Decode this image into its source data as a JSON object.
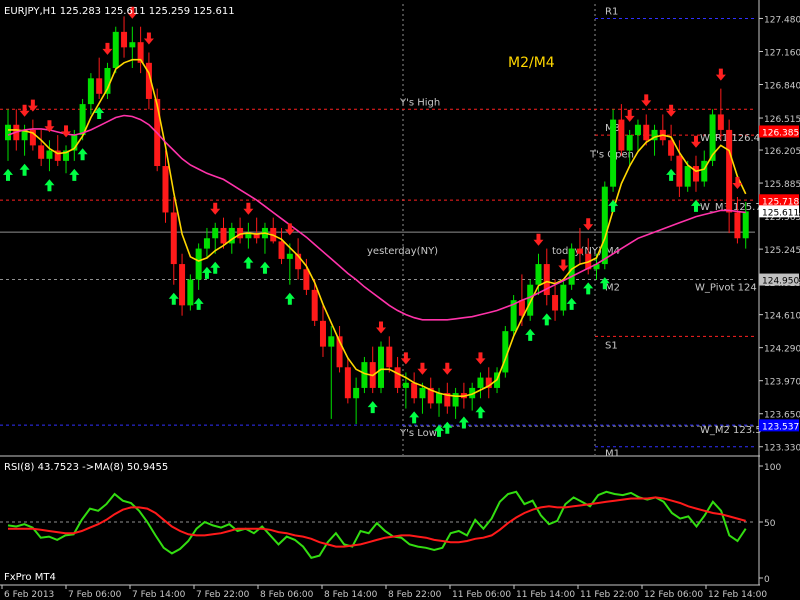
{
  "window": {
    "symbol_header": "EURJPY,H1  125.283 125.611 125.259 125.611",
    "strategy_label": "M2/M4",
    "broker_label": "FxPro MT4"
  },
  "colors": {
    "background": "#000000",
    "axis": "#c8c8c8",
    "bull": "#00e000",
    "bear": "#ff1a1a",
    "ma_fast": "#ffd700",
    "ma_slow": "#ff33aa",
    "arrow_up": "#00ff44",
    "arrow_down": "#ff2020",
    "rsi": "#33dd11",
    "rsi_ma": "#ff1a1a",
    "red_level": "#ff2020",
    "blue_level": "#3030ff",
    "grey_line": "#909090",
    "strategy": "#ffd700"
  },
  "chart_data": [
    {
      "type": "candlestick",
      "title": "EURJPY,H1  125.283 125.611 125.259 125.611",
      "y_ticks": [
        "127.480",
        "127.160",
        "126.840",
        "126.515",
        "126.205",
        "125.885",
        "125.565",
        "125.245",
        "124.925",
        "124.610",
        "124.290",
        "123.970",
        "123.650",
        "123.330"
      ],
      "x_ticks": [
        "6 Feb 2013",
        "7 Feb 06:00",
        "7 Feb 14:00",
        "7 Feb 22:00",
        "8 Feb 06:00",
        "8 Feb 14:00",
        "8 Feb 22:00",
        "11 Feb 06:00",
        "11 Feb 14:00",
        "11 Feb 22:00",
        "12 Feb 06:00",
        "12 Feb 14:00"
      ],
      "ylim": [
        123.25,
        127.62
      ],
      "candles": [
        [
          126.3,
          126.6,
          126.1,
          126.45
        ],
        [
          126.45,
          126.6,
          126.2,
          126.3
        ],
        [
          126.3,
          126.45,
          126.15,
          126.4
        ],
        [
          126.4,
          126.5,
          126.2,
          126.25
        ],
        [
          126.25,
          126.4,
          126.05,
          126.12
        ],
        [
          126.12,
          126.3,
          126.0,
          126.2
        ],
        [
          126.2,
          126.35,
          126.05,
          126.1
        ],
        [
          126.1,
          126.25,
          125.98,
          126.2
        ],
        [
          126.2,
          126.4,
          126.1,
          126.35
        ],
        [
          126.35,
          126.7,
          126.3,
          126.65
        ],
        [
          126.65,
          126.95,
          126.55,
          126.9
        ],
        [
          126.9,
          127.1,
          126.7,
          126.75
        ],
        [
          126.75,
          127.05,
          126.7,
          127.0
        ],
        [
          127.0,
          127.4,
          126.95,
          127.35
        ],
        [
          127.35,
          127.5,
          127.1,
          127.2
        ],
        [
          127.2,
          127.4,
          127.0,
          127.25
        ],
        [
          127.25,
          127.4,
          126.95,
          127.05
        ],
        [
          127.05,
          127.15,
          126.6,
          126.7
        ],
        [
          126.7,
          126.8,
          126.0,
          126.05
        ],
        [
          126.05,
          126.2,
          125.5,
          125.6
        ],
        [
          125.6,
          125.75,
          124.9,
          125.1
        ],
        [
          125.1,
          125.2,
          124.6,
          124.7
        ],
        [
          124.7,
          125.0,
          124.65,
          124.95
        ],
        [
          124.95,
          125.3,
          124.85,
          125.25
        ],
        [
          125.25,
          125.45,
          125.15,
          125.35
        ],
        [
          125.35,
          125.5,
          125.2,
          125.45
        ],
        [
          125.45,
          125.55,
          125.25,
          125.3
        ],
        [
          125.3,
          125.5,
          125.2,
          125.45
        ],
        [
          125.45,
          125.55,
          125.3,
          125.35
        ],
        [
          125.35,
          125.5,
          125.25,
          125.4
        ],
        [
          125.4,
          125.55,
          125.3,
          125.35
        ],
        [
          125.35,
          125.5,
          125.2,
          125.45
        ],
        [
          125.45,
          125.55,
          125.3,
          125.32
        ],
        [
          125.32,
          125.45,
          125.1,
          125.15
        ],
        [
          125.15,
          125.3,
          124.9,
          125.2
        ],
        [
          125.2,
          125.35,
          124.95,
          125.05
        ],
        [
          125.05,
          125.15,
          124.8,
          124.85
        ],
        [
          124.85,
          124.95,
          124.5,
          124.55
        ],
        [
          124.55,
          124.7,
          124.2,
          124.3
        ],
        [
          124.3,
          124.5,
          123.6,
          124.4
        ],
        [
          124.4,
          124.5,
          124.05,
          124.1
        ],
        [
          124.1,
          124.2,
          123.75,
          123.8
        ],
        [
          123.8,
          124.0,
          123.55,
          123.9
        ],
        [
          123.9,
          124.2,
          123.85,
          124.15
        ],
        [
          124.15,
          124.3,
          123.85,
          123.9
        ],
        [
          123.9,
          124.35,
          123.85,
          124.3
        ],
        [
          124.3,
          124.4,
          124.05,
          124.1
        ],
        [
          124.1,
          124.2,
          123.85,
          123.9
        ],
        [
          123.9,
          124.05,
          123.7,
          123.95
        ],
        [
          123.95,
          124.05,
          123.75,
          123.8
        ],
        [
          123.8,
          123.95,
          123.65,
          123.9
        ],
        [
          123.9,
          124.0,
          123.7,
          123.75
        ],
        [
          123.75,
          123.9,
          123.62,
          123.85
        ],
        [
          123.85,
          123.95,
          123.65,
          123.72
        ],
        [
          123.72,
          123.9,
          123.6,
          123.85
        ],
        [
          123.85,
          123.95,
          123.7,
          123.8
        ],
        [
          123.8,
          123.95,
          123.68,
          123.9
        ],
        [
          123.9,
          124.05,
          123.8,
          124.0
        ],
        [
          124.0,
          124.1,
          123.8,
          123.9
        ],
        [
          123.9,
          124.1,
          123.85,
          124.05
        ],
        [
          124.05,
          124.5,
          124.0,
          124.45
        ],
        [
          124.45,
          124.8,
          124.4,
          124.75
        ],
        [
          124.75,
          125.0,
          124.5,
          124.6
        ],
        [
          124.6,
          124.95,
          124.55,
          124.9
        ],
        [
          124.9,
          125.2,
          124.8,
          125.1
        ],
        [
          125.1,
          125.25,
          124.7,
          124.8
        ],
        [
          124.8,
          124.95,
          124.55,
          124.65
        ],
        [
          124.65,
          124.95,
          124.6,
          124.9
        ],
        [
          124.9,
          125.3,
          124.85,
          125.25
        ],
        [
          125.25,
          125.45,
          125.1,
          125.2
        ],
        [
          125.2,
          125.35,
          125.0,
          125.05
        ],
        [
          125.05,
          125.2,
          124.95,
          125.1
        ],
        [
          125.1,
          125.9,
          125.05,
          125.85
        ],
        [
          125.85,
          126.6,
          125.8,
          126.5
        ],
        [
          126.5,
          126.65,
          126.15,
          126.2
        ],
        [
          126.2,
          126.4,
          126.05,
          126.35
        ],
        [
          126.35,
          126.5,
          126.2,
          126.45
        ],
        [
          126.45,
          126.55,
          126.25,
          126.3
        ],
        [
          126.3,
          126.45,
          126.15,
          126.4
        ],
        [
          126.4,
          126.55,
          126.25,
          126.3
        ],
        [
          126.3,
          126.45,
          126.1,
          126.15
        ],
        [
          126.15,
          126.3,
          125.75,
          125.85
        ],
        [
          125.85,
          126.1,
          125.8,
          126.05
        ],
        [
          126.05,
          126.15,
          125.8,
          125.9
        ],
        [
          125.9,
          126.2,
          125.85,
          126.1
        ],
        [
          126.1,
          126.6,
          126.05,
          126.55
        ],
        [
          126.55,
          126.8,
          126.3,
          126.4
        ],
        [
          126.4,
          126.5,
          125.4,
          125.6
        ],
        [
          125.6,
          125.75,
          125.3,
          125.35
        ],
        [
          125.35,
          125.7,
          125.25,
          125.61
        ]
      ],
      "series": [
        {
          "name": "",
          "values": [
            126.4,
            126.4,
            126.39,
            126.37,
            126.3,
            126.22,
            126.17,
            126.18,
            126.22,
            126.34,
            126.52,
            126.66,
            126.8,
            126.99,
            127.05,
            127.08,
            127.08,
            126.95,
            126.64,
            126.24,
            125.79,
            125.39,
            125.17,
            125.13,
            125.16,
            125.23,
            125.28,
            125.34,
            125.39,
            125.4,
            125.39,
            125.4,
            125.38,
            125.34,
            125.26,
            125.18,
            125.08,
            124.92,
            124.71,
            124.53,
            124.35,
            124.19,
            124.08,
            124.04,
            124.02,
            124.08,
            124.08,
            124.04,
            124.0,
            123.95,
            123.92,
            123.88,
            123.85,
            123.83,
            123.82,
            123.82,
            123.84,
            123.88,
            123.92,
            123.98,
            124.18,
            124.4,
            124.57,
            124.73,
            124.89,
            124.93,
            124.91,
            124.95,
            125.05,
            125.1,
            125.12,
            125.16,
            125.35,
            125.62,
            125.88,
            126.05,
            126.19,
            126.28,
            126.33,
            126.35,
            126.33,
            126.18,
            126.06,
            126.0,
            126.02,
            126.16,
            126.25,
            126.2,
            125.95,
            125.78
          ]
        },
        {
          "name": "",
          "values": [
            126.35,
            126.38,
            126.4,
            126.41,
            126.41,
            126.4,
            126.38,
            126.36,
            126.35,
            126.37,
            126.4,
            126.44,
            126.48,
            126.52,
            126.54,
            126.53,
            126.5,
            126.45,
            126.37,
            126.28,
            126.2,
            126.12,
            126.06,
            126.02,
            125.98,
            125.95,
            125.92,
            125.87,
            125.82,
            125.77,
            125.72,
            125.66,
            125.6,
            125.54,
            125.48,
            125.42,
            125.36,
            125.29,
            125.22,
            125.15,
            125.08,
            125.01,
            124.95,
            124.88,
            124.82,
            124.76,
            124.7,
            124.65,
            124.61,
            124.58,
            124.56,
            124.56,
            124.56,
            124.56,
            124.57,
            124.58,
            124.59,
            124.61,
            124.63,
            124.65,
            124.68,
            124.71,
            124.75,
            124.78,
            124.82,
            124.86,
            124.9,
            124.94,
            124.98,
            125.02,
            125.06,
            125.1,
            125.15,
            125.2,
            125.25,
            125.3,
            125.35,
            125.38,
            125.41,
            125.44,
            125.47,
            125.5,
            125.53,
            125.56,
            125.58,
            125.6,
            125.62,
            125.62,
            125.61,
            125.6
          ]
        }
      ],
      "arrows_up": [
        0,
        2,
        5,
        8,
        9,
        11,
        20,
        23,
        24,
        25,
        29,
        31,
        34,
        44,
        49,
        52,
        53,
        55,
        57,
        63,
        65,
        68,
        70,
        72,
        73,
        80,
        83
      ],
      "arrows_down": [
        2,
        3,
        5,
        7,
        12,
        15,
        17,
        25,
        29,
        34,
        45,
        48,
        50,
        53,
        57,
        64,
        67,
        70,
        75,
        77,
        80,
        83,
        86,
        88
      ],
      "levels": [
        {
          "label": "R1",
          "value": 127.48,
          "style": "blue"
        },
        {
          "label": "Y's High",
          "value": 126.6,
          "style": "redgrey"
        },
        {
          "label": "M3",
          "value": 126.35,
          "style": "redgrey"
        },
        {
          "label": "T's Open",
          "value": 126.25,
          "style": "grey"
        },
        {
          "label": "W_R1 126.4",
          "value": 126.39,
          "style": "red"
        },
        {
          "label": "W_M3 125.7",
          "value": 125.72,
          "style": "red"
        },
        {
          "label": "yesterday(NY)",
          "value": 125.41,
          "style": "greyline"
        },
        {
          "label": "today(NY) M4",
          "value": 125.41,
          "style": "greyline"
        },
        {
          "label": "W_Pivot 124",
          "value": 124.95,
          "style": "grey"
        },
        {
          "label": "M2",
          "value": 124.95,
          "style": "grey"
        },
        {
          "label": "S1",
          "value": 124.4,
          "style": "red"
        },
        {
          "label": "Y's Low",
          "value": 123.53,
          "style": "redgrey"
        },
        {
          "label": "W_M2 123.5",
          "value": 123.54,
          "style": "blue"
        },
        {
          "label": "M1",
          "value": 123.33,
          "style": "blue"
        }
      ],
      "price_badges": [
        {
          "text": "126.385",
          "value": 126.385,
          "bg": "#ff0000",
          "fg": "#ffffff"
        },
        {
          "text": "125.718",
          "value": 125.718,
          "bg": "#ff0000",
          "fg": "#ffffff"
        },
        {
          "text": "125.611",
          "value": 125.611,
          "bg": "#ffffff",
          "fg": "#000000"
        },
        {
          "text": "124.950",
          "value": 124.95,
          "bg": "#c0c0c0",
          "fg": "#000000"
        },
        {
          "text": "123.537",
          "value": 123.537,
          "bg": "#0000ff",
          "fg": "#ffffff"
        }
      ]
    },
    {
      "type": "line",
      "title": "RSI(8) 43.7523  ->MA(8) 50.9455",
      "ylim": [
        0,
        100
      ],
      "y_ticks": [
        "100",
        "50",
        "0"
      ],
      "reference_line": 50,
      "series": [
        {
          "name": "RSI(8)",
          "values": [
            47,
            46,
            48,
            45,
            36,
            37,
            34,
            38,
            39,
            52,
            62,
            60,
            66,
            75,
            69,
            67,
            60,
            50,
            38,
            27,
            22,
            26,
            33,
            44,
            50,
            47,
            45,
            48,
            42,
            44,
            40,
            46,
            38,
            30,
            37,
            34,
            28,
            18,
            20,
            32,
            40,
            30,
            28,
            42,
            40,
            49,
            42,
            37,
            36,
            30,
            28,
            27,
            25,
            27,
            40,
            42,
            38,
            52,
            44,
            53,
            68,
            75,
            77,
            66,
            69,
            56,
            48,
            51,
            66,
            72,
            68,
            64,
            74,
            77,
            75,
            74,
            76,
            72,
            70,
            72,
            68,
            58,
            53,
            55,
            46,
            56,
            68,
            60,
            38,
            33,
            44
          ]
        },
        {
          "name": "MA(8)",
          "values": [
            44,
            44,
            44,
            44,
            43,
            42,
            41,
            40,
            40,
            42,
            45,
            48,
            52,
            57,
            61,
            63,
            63,
            62,
            58,
            52,
            46,
            42,
            39,
            38,
            38,
            39,
            40,
            42,
            44,
            44,
            44,
            44,
            43,
            41,
            40,
            38,
            37,
            35,
            32,
            30,
            28,
            28,
            29,
            30,
            32,
            34,
            36,
            37,
            38,
            38,
            37,
            36,
            34,
            33,
            32,
            32,
            33,
            35,
            36,
            38,
            43,
            49,
            54,
            58,
            61,
            63,
            64,
            63,
            63,
            64,
            65,
            66,
            67,
            68,
            69,
            70,
            71,
            71,
            71,
            72,
            71,
            69,
            67,
            64,
            62,
            60,
            58,
            57,
            55,
            53,
            51
          ]
        }
      ]
    }
  ]
}
